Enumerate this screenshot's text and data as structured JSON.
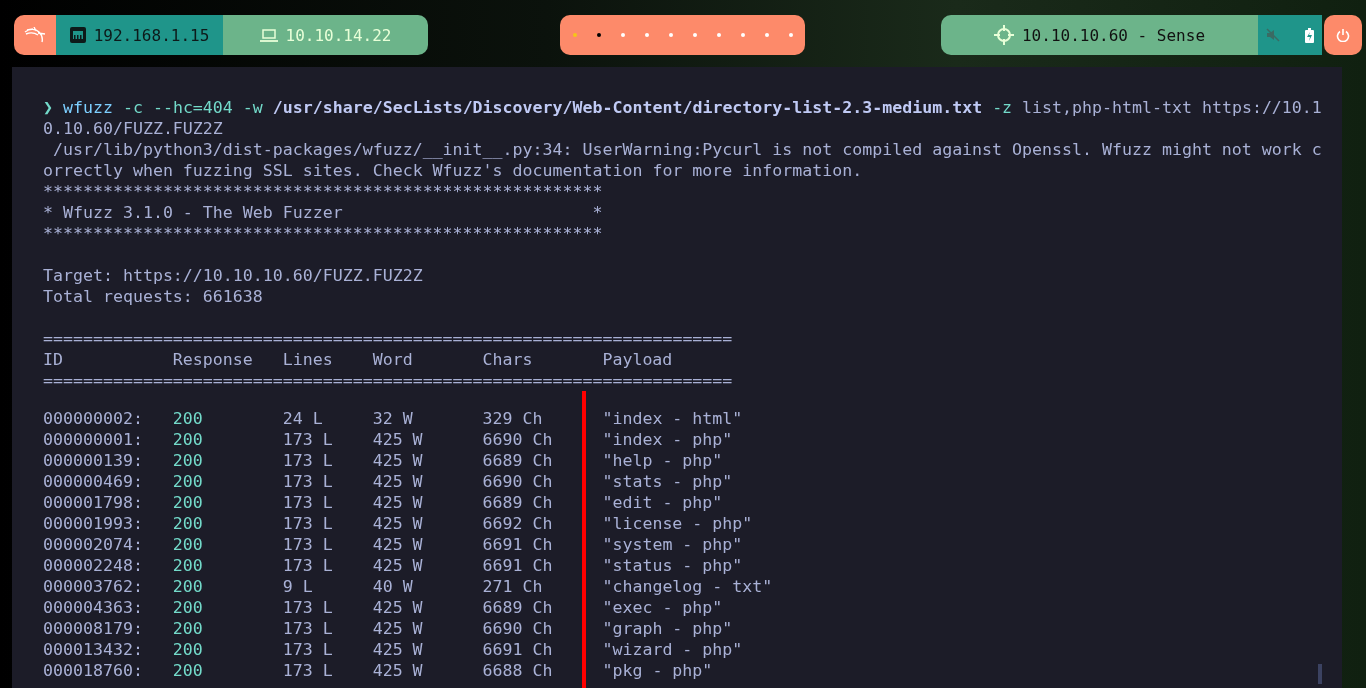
{
  "top_bar": {
    "lan_ip": "192.168.1.15",
    "vpn_ip": "10.10.14.22",
    "workspaces": [
      {
        "kind": "current"
      },
      {
        "kind": "occupied"
      },
      {
        "kind": "empty"
      },
      {
        "kind": "empty"
      },
      {
        "kind": "empty"
      },
      {
        "kind": "empty"
      },
      {
        "kind": "empty"
      },
      {
        "kind": "empty"
      },
      {
        "kind": "empty"
      },
      {
        "kind": "empty"
      }
    ],
    "target": "10.10.10.60 - Sense",
    "muted": true
  },
  "terminal": {
    "command": {
      "prompt": "❯",
      "segments": [
        {
          "kind": "program",
          "text": "wfuzz"
        },
        {
          "kind": "flag",
          "text": "-c --hc=404 -w"
        },
        {
          "kind": "path",
          "text": "/usr/share/SecLists/Discovery/Web-Content/directory-list-2.3-medium.txt"
        },
        {
          "kind": "flag",
          "text": "-z"
        },
        {
          "kind": "arg",
          "text": "list,php-html-txt https://10.10.10.60/FUZZ.FUZ2Z"
        }
      ]
    },
    "warning": " /usr/lib/python3/dist-packages/wfuzz/__init__.py:34: UserWarning:Pycurl is not compiled against Openssl. Wfuzz might not work correctly when fuzzing SSL sites. Check Wfuzz's documentation for more information.",
    "banner": [
      "********************************************************",
      "* Wfuzz 3.1.0 - The Web Fuzzer                         *",
      "********************************************************"
    ],
    "target": "Target: https://10.10.10.60/FUZZ.FUZ2Z",
    "total": "Total requests: 661638",
    "rule_top": "=====================================================================",
    "columns": [
      "ID",
      "Response",
      "Lines",
      "Word",
      "Chars",
      "Payload"
    ],
    "rule_bottom": "=====================================================================",
    "rows": [
      [
        "000000002:",
        "200",
        "24 L",
        "32 W",
        "329 Ch",
        "\"index - html\""
      ],
      [
        "000000001:",
        "200",
        "173 L",
        "425 W",
        "6690 Ch",
        "\"index - php\""
      ],
      [
        "000000139:",
        "200",
        "173 L",
        "425 W",
        "6689 Ch",
        "\"help - php\""
      ],
      [
        "000000469:",
        "200",
        "173 L",
        "425 W",
        "6690 Ch",
        "\"stats - php\""
      ],
      [
        "000001798:",
        "200",
        "173 L",
        "425 W",
        "6689 Ch",
        "\"edit - php\""
      ],
      [
        "000001993:",
        "200",
        "173 L",
        "425 W",
        "6692 Ch",
        "\"license - php\""
      ],
      [
        "000002074:",
        "200",
        "173 L",
        "425 W",
        "6691 Ch",
        "\"system - php\""
      ],
      [
        "000002248:",
        "200",
        "173 L",
        "425 W",
        "6691 Ch",
        "\"status - php\""
      ],
      [
        "000003762:",
        "200",
        "9 L",
        "40 W",
        "271 Ch",
        "\"changelog - txt\""
      ],
      [
        "000004363:",
        "200",
        "173 L",
        "425 W",
        "6689 Ch",
        "\"exec - php\""
      ],
      [
        "000008179:",
        "200",
        "173 L",
        "425 W",
        "6690 Ch",
        "\"graph - php\""
      ],
      [
        "000013432:",
        "200",
        "173 L",
        "425 W",
        "6691 Ch",
        "\"wizard - php\""
      ],
      [
        "000018760:",
        "200",
        "173 L",
        "425 W",
        "6688 Ch",
        "\"pkg - php\""
      ]
    ]
  }
}
